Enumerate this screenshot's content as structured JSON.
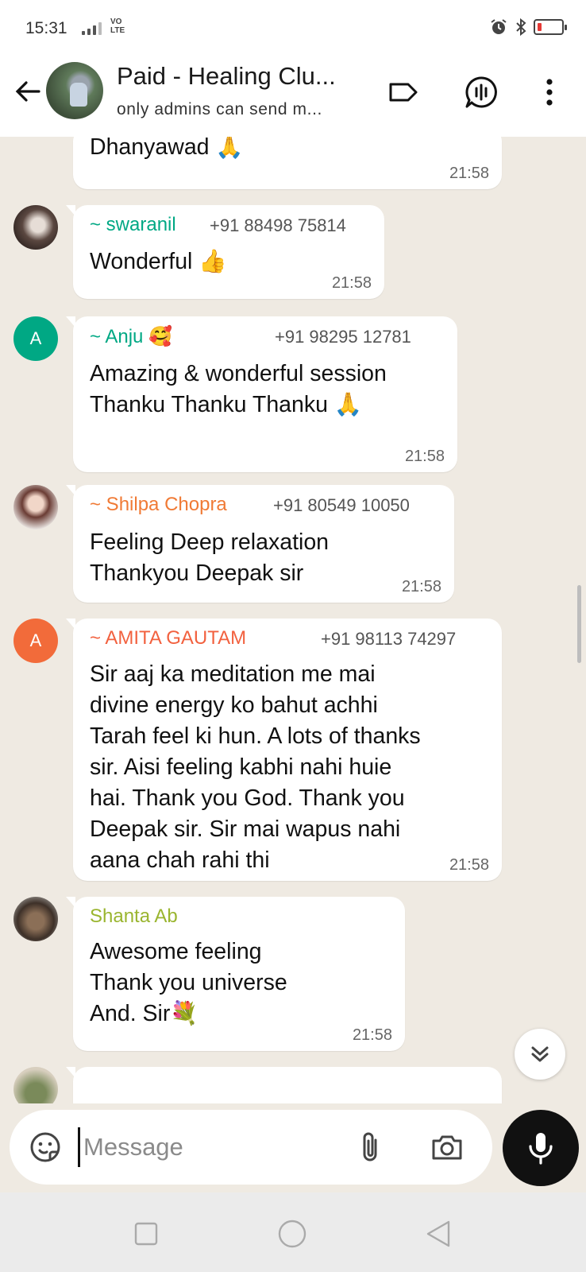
{
  "status_bar": {
    "time": "15:31",
    "network": "VO\nLTE",
    "battery_level": 0.1
  },
  "header": {
    "title": "Paid - Healing Clu...",
    "subtitle": "only admins can send m...",
    "icons": [
      "back-arrow-icon",
      "label-icon",
      "voice-chat-icon",
      "more-vert-icon"
    ]
  },
  "messages": [
    {
      "text": "Dhanyawad 🙏",
      "time": "21:58"
    },
    {
      "sender": "~ swaranil",
      "sender_color": "#00a884",
      "phone": "+91 88498 75814",
      "text": "Wonderful 👍",
      "time": "21:58"
    },
    {
      "sender": "~ Anju 🥰",
      "sender_color": "#00a884",
      "avatar_letter": "A",
      "avatar_color": "#00a884",
      "phone": "+91 98295 12781",
      "text": "Amazing & wonderful session\nThanku Thanku Thanku 🙏",
      "time": "21:58"
    },
    {
      "sender": "~ Shilpa Chopra",
      "sender_color": "#f07a35",
      "phone": "+91 80549 10050",
      "text": "Feeling Deep relaxation\nThankyou Deepak sir",
      "time": "21:58"
    },
    {
      "sender": "~ AMITA GAUTAM",
      "sender_color": "#f2613f",
      "avatar_letter": "A",
      "avatar_color": "#f26b3a",
      "phone": "+91 98113 74297",
      "text": "Sir aaj ka meditation me mai\ndivine  energy ko bahut achhi\nTarah feel ki hun. A lots of thanks\nsir. Aisi feeling kabhi nahi huie\nhai. Thank you God. Thank you\nDeepak sir. Sir mai wapus nahi\naana chah rahi thi",
      "time": "21:58"
    },
    {
      "sender": "Shanta Ab",
      "sender_color": "#9ab52f",
      "text": "Awesome  feeling\nThank you universe\nAnd. Sir💐",
      "time": "21:58"
    }
  ],
  "composer": {
    "placeholder": "Message"
  },
  "colors": {
    "chat_background": "#efeae2",
    "bubble": "#ffffff",
    "mic_button": "#111111"
  }
}
